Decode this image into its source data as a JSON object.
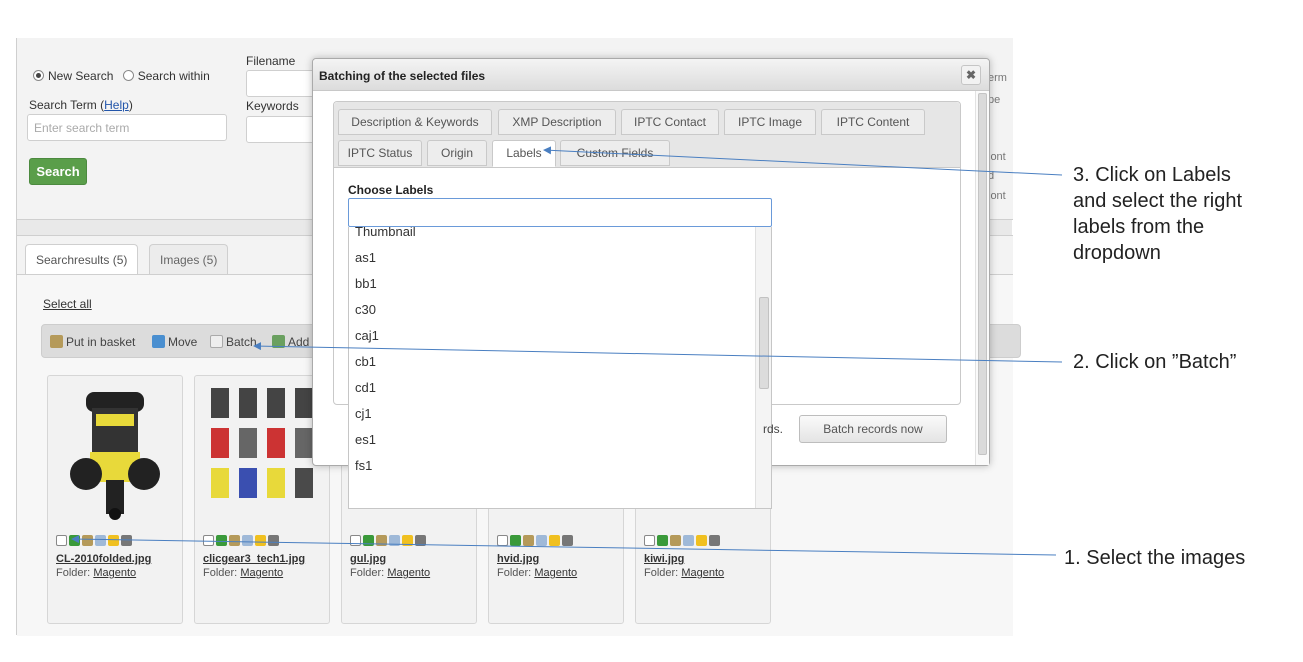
{
  "search": {
    "new_search_label": "New Search",
    "search_within_label": "Search within",
    "term_label": "Search Term (",
    "help_link": "Help",
    "term_close": ")",
    "term_placeholder": "Enter search term",
    "filename_label": "Filename",
    "keywords_label": "Keywords",
    "search_button": "Search",
    "right_fragments": [
      "erm",
      "pe",
      "lont",
      "d",
      "lont"
    ]
  },
  "results": {
    "tabs": [
      "Searchresults (5)",
      "Images (5)"
    ],
    "select_all": "Select all",
    "toolbar": {
      "put_in_basket": "Put in basket",
      "move": "Move",
      "batch": "Batch",
      "add": "Add"
    },
    "cards": [
      {
        "filename": "CL-2010folded.jpg",
        "folder_label": "Folder:",
        "folder": "Magento"
      },
      {
        "filename": "clicgear3_tech1.jpg",
        "folder_label": "Folder:",
        "folder": "Magento"
      },
      {
        "filename": "gul.jpg",
        "folder_label": "Folder:",
        "folder": "Magento"
      },
      {
        "filename": "hvid.jpg",
        "folder_label": "Folder:",
        "folder": "Magento"
      },
      {
        "filename": "kiwi.jpg",
        "folder_label": "Folder:",
        "folder": "Magento"
      }
    ]
  },
  "modal": {
    "title": "Batching of the selected files",
    "close_glyph": "✖",
    "tabs_row1": [
      "Description & Keywords",
      "XMP Description",
      "IPTC Contact",
      "IPTC Image",
      "IPTC Content"
    ],
    "tabs_row2": [
      "IPTC Status",
      "Origin",
      "Labels",
      "Custom Fields"
    ],
    "active_tab": "Labels",
    "choose_labels": "Choose Labels",
    "labels_input_value": "",
    "dropdown_options": [
      "Thumbnail",
      "as1",
      "bb1",
      "c30",
      "caj1",
      "cb1",
      "cd1",
      "cj1",
      "es1",
      "fs1"
    ],
    "batch_hint": "rds.",
    "batch_now_button": "Batch records now"
  },
  "annotations": {
    "step3_line1": "3. Click on Labels",
    "step3_line2": "and select the right",
    "step3_line3": "labels from the",
    "step3_line4": "dropdown",
    "step2": "2. Click on ”Batch”",
    "step1": "1. Select the images"
  },
  "colors": {
    "search_button": "#5a9e4a",
    "annotation_line": "#4a7fc1",
    "input_focus": "#6a9ad9"
  }
}
